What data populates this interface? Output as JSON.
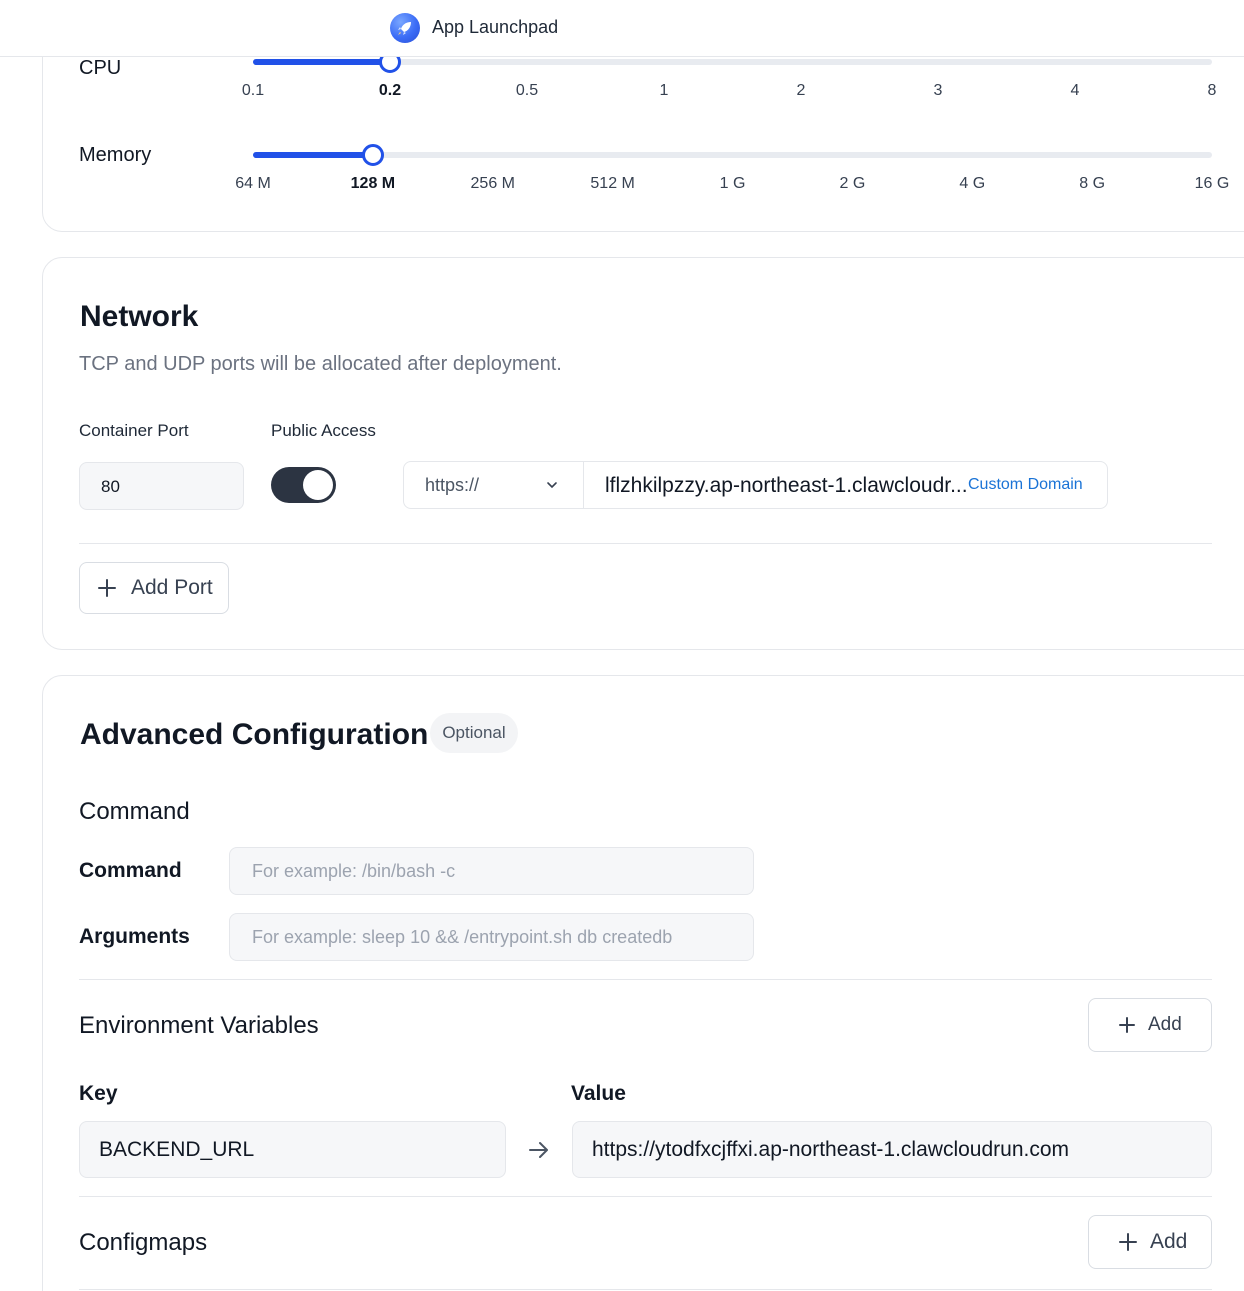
{
  "app": {
    "title": "App Launchpad"
  },
  "resources": {
    "cpu": {
      "label": "CPU",
      "ticks": [
        "0.1",
        "0.2",
        "0.5",
        "1",
        "2",
        "3",
        "4",
        "8"
      ],
      "selected": "0.2",
      "selected_index": 1
    },
    "memory": {
      "label": "Memory",
      "ticks": [
        "64 M",
        "128 M",
        "256 M",
        "512 M",
        "1 G",
        "2 G",
        "4 G",
        "8 G",
        "16 G"
      ],
      "selected": "128 M",
      "selected_index": 1
    },
    "accent_color": "#2151e8"
  },
  "network": {
    "title": "Network",
    "description": "TCP and UDP ports will be allocated after deployment.",
    "container_port_label": "Container Port",
    "public_access_label": "Public Access",
    "container_port": "80",
    "public_access_enabled": true,
    "protocol": "https://",
    "domain": "lflzhkilpzzy.ap-northeast-1.clawcloudr...",
    "custom_domain_label": "Custom Domain",
    "add_port_label": "Add Port"
  },
  "advanced": {
    "title": "Advanced Configuration",
    "badge": "Optional",
    "command_section_title": "Command",
    "command_label": "Command",
    "command_placeholder": "For example:  /bin/bash -c",
    "arguments_label": "Arguments",
    "arguments_placeholder": "For example:  sleep 10 && /entrypoint.sh db createdb",
    "env_title": "Environment Variables",
    "env_add_label": "Add",
    "key_label": "Key",
    "value_label": "Value",
    "env_vars": [
      {
        "key": "BACKEND_URL",
        "value": "https://ytodfxcjffxi.ap-northeast-1.clawcloudrun.com"
      }
    ],
    "configmaps_title": "Configmaps",
    "configmaps_add_label": "Add"
  },
  "icons": {
    "logo": "rocket-icon",
    "protocol_chevron": "chevron-down-icon",
    "plus": "plus-icon",
    "kv_arrow": "arrow-right-icon"
  }
}
